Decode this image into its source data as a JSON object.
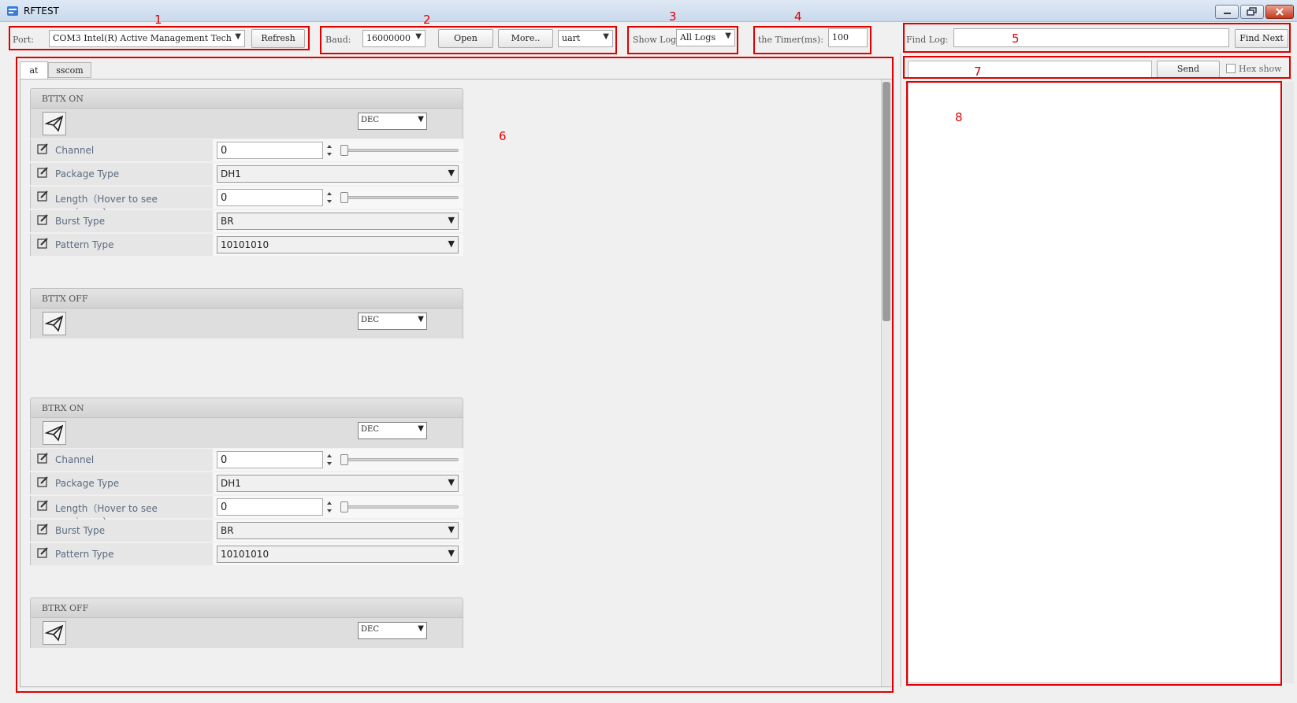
{
  "window": {
    "title": "RFTEST"
  },
  "toolbar": {
    "port_label": "Port:",
    "port_value": "COM3  Intel(R) Active Management Tech",
    "refresh_label": "Refresh",
    "baud_label": "Baud:",
    "baud_value": "16000000",
    "open_label": "Open",
    "more_label": "More..",
    "iface_value": "uart",
    "showlog_label": "Show Log",
    "showlog_value": "All Logs",
    "timer_label": "the Timer(ms):",
    "timer_value": "100",
    "findlog_label": "Find Log:",
    "findlog_value": "",
    "findnext_label": "Find Next"
  },
  "tabs": [
    {
      "label": "at",
      "active": true
    },
    {
      "label": "sscom",
      "active": false
    }
  ],
  "groups": [
    {
      "title": "BTTX ON",
      "format": "DEC",
      "rows": [
        {
          "label": "Channel",
          "kind": "spin",
          "value": "0"
        },
        {
          "label": "Package Type",
          "kind": "select",
          "value": "DH1"
        },
        {
          "label": "Length（Hover to see maximum）",
          "kind": "spin",
          "value": "0"
        },
        {
          "label": "Burst Type",
          "kind": "select",
          "value": "BR"
        },
        {
          "label": "Pattern Type",
          "kind": "select",
          "value": "10101010"
        }
      ]
    },
    {
      "title": "BTTX OFF",
      "format": "DEC",
      "rows": []
    },
    {
      "title": "BTRX ON",
      "format": "DEC",
      "rows": [
        {
          "label": "Channel",
          "kind": "spin",
          "value": "0"
        },
        {
          "label": "Package Type",
          "kind": "select",
          "value": "DH1"
        },
        {
          "label": "Length（Hover to see maximum）",
          "kind": "spin",
          "value": "0"
        },
        {
          "label": "Burst Type",
          "kind": "select",
          "value": "BR"
        },
        {
          "label": "Pattern Type",
          "kind": "select",
          "value": "10101010"
        }
      ]
    },
    {
      "title": "BTRX OFF",
      "format": "DEC",
      "rows": []
    }
  ],
  "right_panel": {
    "send_input_value": "",
    "send_label": "Send",
    "hex_show_label": "Hex show",
    "hex_show_checked": false
  },
  "annotations": [
    "1",
    "2",
    "3",
    "4",
    "5",
    "6",
    "7",
    "8"
  ],
  "colors": {
    "annotation": "#e00000"
  },
  "icons": {
    "send": "paper-plane-icon",
    "edit": "edit-pencil-icon"
  }
}
